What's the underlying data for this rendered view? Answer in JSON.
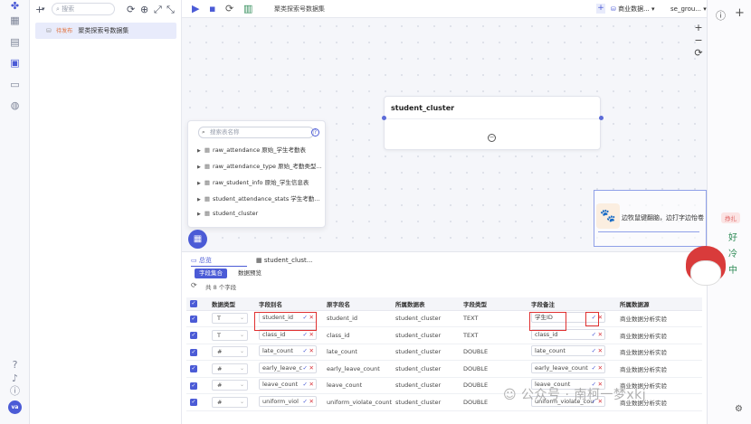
{
  "left_panel": {
    "search_placeholder": "搜索",
    "item": {
      "tag": "待发布",
      "label": "聚类探索号数据集"
    }
  },
  "topbar": {
    "title": "聚类探索号数据集",
    "dataset_select": "商业数据...",
    "group_select": "se_grou..."
  },
  "canvas": {
    "node_title": "student_cluster",
    "zoom_in": "+",
    "zoom_out": "−",
    "reset": "⟳"
  },
  "table_list": {
    "search_placeholder": "搜索表名称",
    "rows": [
      "raw_attendance  原始_学生考勤表",
      "raw_attendance_type  原始_考勤类型...",
      "raw_student_info  原始_学生信息表",
      "student_attendance_stats  学生考勤...",
      "student_cluster"
    ]
  },
  "bottom": {
    "tabs": [
      "总览",
      "student_clust..."
    ],
    "subtabs": [
      "字段集合",
      "数据预览"
    ],
    "field_count": "共 8 个字段",
    "headers": [
      "数据类型",
      "字段别名",
      "原字段名",
      "所属数据表",
      "字段类型",
      "字段备注",
      "所属数据源"
    ],
    "rows": [
      {
        "type": "T",
        "alias": "student_id",
        "orig": "student_id",
        "table": "student_cluster",
        "ftype": "TEXT",
        "remark": "学生ID",
        "source": "商业数据分析实验"
      },
      {
        "type": "T",
        "alias": "class_id",
        "orig": "class_id",
        "table": "student_cluster",
        "ftype": "TEXT",
        "remark": "class_id",
        "source": "商业数据分析实验"
      },
      {
        "type": "#",
        "alias": "late_count",
        "orig": "late_count",
        "table": "student_cluster",
        "ftype": "DOUBLE",
        "remark": "late_count",
        "source": "商业数据分析实验"
      },
      {
        "type": "#",
        "alias": "early_leave_c",
        "orig": "early_leave_count",
        "table": "student_cluster",
        "ftype": "DOUBLE",
        "remark": "early_leave_count",
        "source": "商业数据分析实验"
      },
      {
        "type": "#",
        "alias": "leave_count",
        "orig": "leave_count",
        "table": "student_cluster",
        "ftype": "DOUBLE",
        "remark": "leave_count",
        "source": "商业数据分析实验"
      },
      {
        "type": "#",
        "alias": "uniform_viol",
        "orig": "uniform_violate_count",
        "table": "student_cluster",
        "ftype": "DOUBLE",
        "remark": "uniform_violate_cou",
        "source": "商业数据分析实验"
      }
    ]
  },
  "sticker": {
    "text": "边牧鼠键翻脑，边打字边怡卷",
    "badge": "挣扎",
    "side_text": "好 冷 中"
  },
  "watermark": "公众号 · 南柯一梦xkj",
  "avatar": "va",
  "colors": {
    "accent": "#4b5bd6",
    "highlight": "#e03030"
  }
}
